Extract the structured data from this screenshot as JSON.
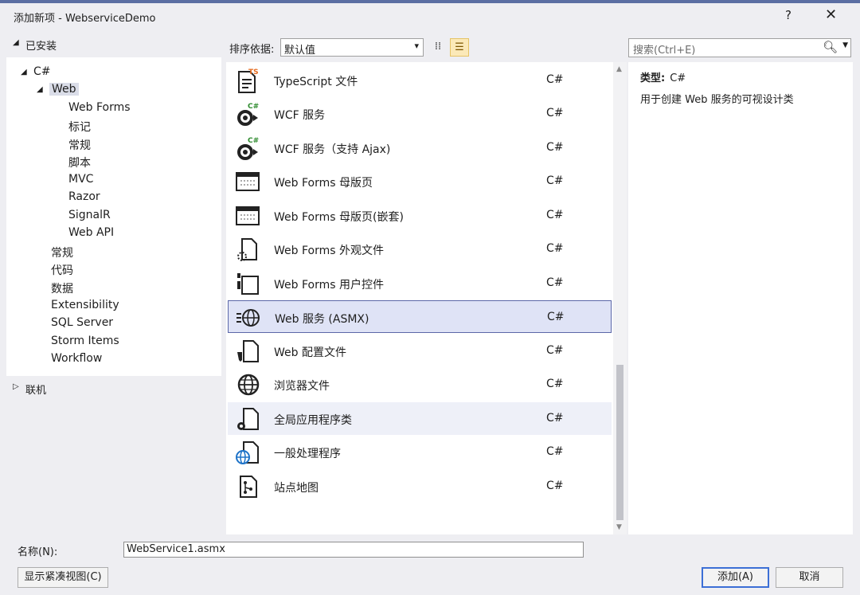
{
  "window": {
    "title": "添加新项 - WebserviceDemo",
    "help": "?",
    "close": "✕"
  },
  "left": {
    "installed_label": "已安装",
    "online_label": "联机",
    "tree": {
      "csharp": "C#",
      "web": "Web",
      "web_children": [
        "Web Forms",
        "标记",
        "常规",
        "脚本",
        "MVC",
        "Razor",
        "SignalR",
        "Web API"
      ],
      "csharp_children": [
        "常规",
        "代码",
        "数据",
        "Extensibility",
        "SQL Server",
        "Storm Items",
        "Workflow"
      ]
    }
  },
  "sort": {
    "label": "排序依据:",
    "value": "默认值"
  },
  "search": {
    "placeholder": "搜索(Ctrl+E)"
  },
  "templates": [
    {
      "name": "TypeScript 文件",
      "lang": "C#",
      "icon": "typescript-file-icon"
    },
    {
      "name": "WCF 服务",
      "lang": "C#",
      "icon": "wcf-service-icon"
    },
    {
      "name": "WCF 服务（支持 Ajax)",
      "lang": "C#",
      "icon": "wcf-ajax-service-icon"
    },
    {
      "name": "Web Forms 母版页",
      "lang": "C#",
      "icon": "master-page-icon"
    },
    {
      "name": "Web Forms 母版页(嵌套)",
      "lang": "C#",
      "icon": "nested-master-page-icon"
    },
    {
      "name": "Web Forms 外观文件",
      "lang": "C#",
      "icon": "skin-file-icon"
    },
    {
      "name": "Web Forms 用户控件",
      "lang": "C#",
      "icon": "user-control-icon"
    },
    {
      "name": "Web 服务 (ASMX)",
      "lang": "C#",
      "icon": "web-service-icon"
    },
    {
      "name": "Web 配置文件",
      "lang": "C#",
      "icon": "web-config-icon"
    },
    {
      "name": "浏览器文件",
      "lang": "C#",
      "icon": "browser-file-icon"
    },
    {
      "name": "全局应用程序类",
      "lang": "C#",
      "icon": "global-app-class-icon"
    },
    {
      "name": "一般处理程序",
      "lang": "C#",
      "icon": "generic-handler-icon"
    },
    {
      "name": "站点地图",
      "lang": "C#",
      "icon": "sitemap-icon"
    }
  ],
  "selected_template": "Web 服务 (ASMX)",
  "details": {
    "type_label": "类型:",
    "type_value": "C#",
    "description": "用于创建 Web 服务的可视设计类"
  },
  "bottom": {
    "name_label": "名称(N):",
    "name_value": "WebService1.asmx",
    "compact_view": "显示紧凑视图(C)",
    "add": "添加(A)",
    "cancel": "取消"
  },
  "colors": {
    "selected_bg": "#dfe3f6",
    "selected_border": "#5b67a8",
    "accent": "#3c6fd6",
    "ts_orange": "#e56b1f",
    "csharp_green": "#2e8b2e"
  }
}
